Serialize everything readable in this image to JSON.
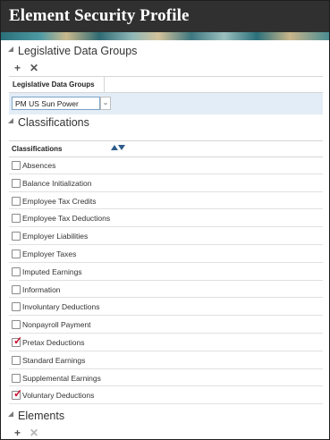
{
  "app": {
    "title": "Element Security Profile"
  },
  "legislative_section": {
    "title": "Legislative Data Groups",
    "toolbar": {
      "add": "+",
      "delete": "✕"
    },
    "table": {
      "column_header": "Legislative Data Groups",
      "row_value": "PM US Sun Power"
    }
  },
  "classifications_section": {
    "title": "Classifications",
    "column_header": "Classifications",
    "items": [
      {
        "label": "Absences",
        "checked": false
      },
      {
        "label": "Balance Initialization",
        "checked": false
      },
      {
        "label": "Employee Tax Credits",
        "checked": false
      },
      {
        "label": "Employee Tax Deductions",
        "checked": false
      },
      {
        "label": "Employer Liabilities",
        "checked": false
      },
      {
        "label": "Employer Taxes",
        "checked": false
      },
      {
        "label": "Imputed Earnings",
        "checked": false
      },
      {
        "label": "Information",
        "checked": false
      },
      {
        "label": "Involuntary Deductions",
        "checked": false
      },
      {
        "label": "Nonpayroll Payment",
        "checked": false
      },
      {
        "label": "Pretax Deductions",
        "checked": true
      },
      {
        "label": "Standard Earnings",
        "checked": false
      },
      {
        "label": "Supplemental Earnings",
        "checked": false
      },
      {
        "label": "Voluntary Deductions",
        "checked": true
      }
    ]
  },
  "elements_section": {
    "title": "Elements",
    "toolbar": {
      "add": "+",
      "delete": "✕"
    }
  },
  "colors": {
    "titlebar": "#303030",
    "selected_row": "#e3edf7",
    "check_mark": "#c8102e",
    "sort_arrow": "#2d5c8a"
  }
}
